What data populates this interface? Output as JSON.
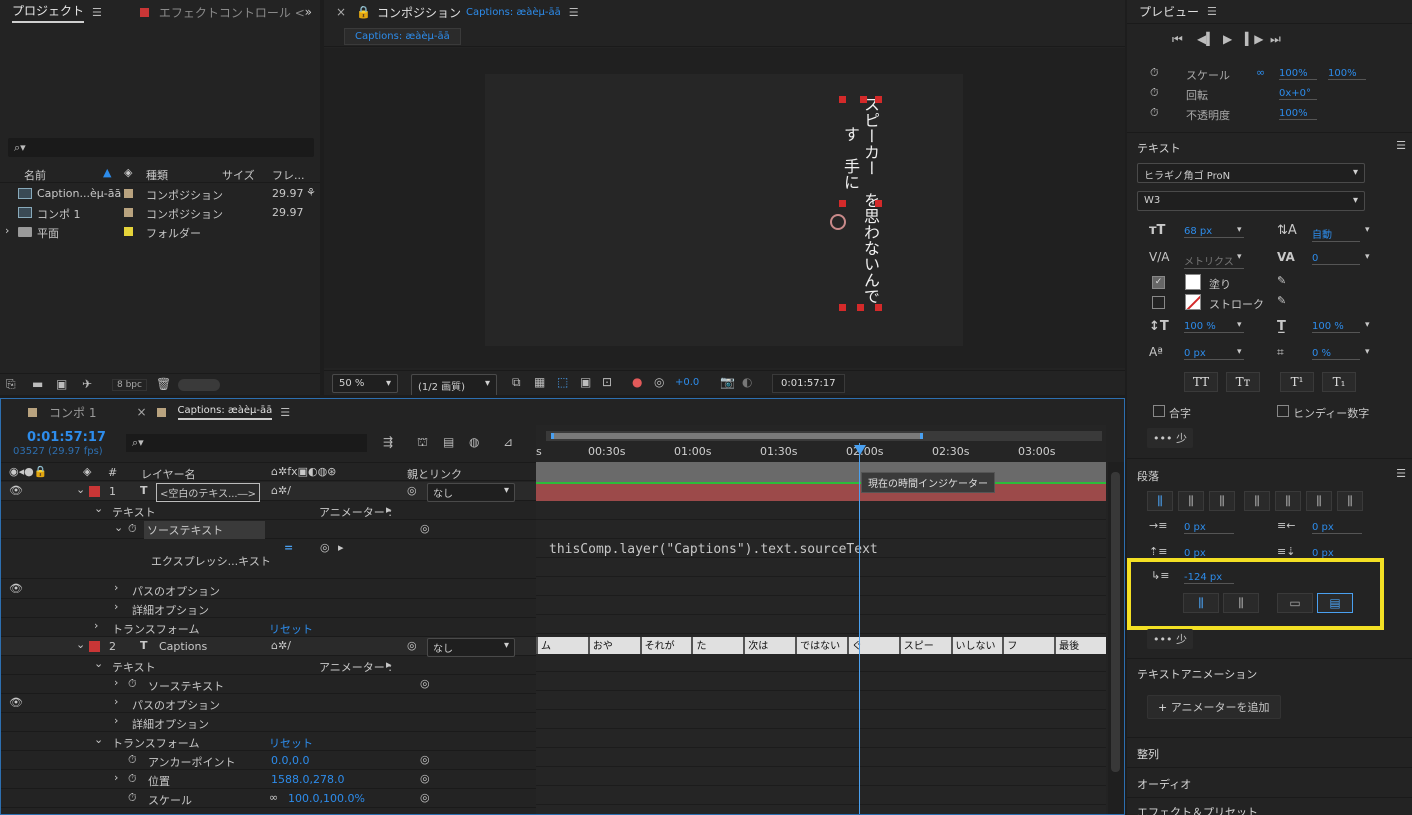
{
  "project": {
    "tab_project": "プロジェクト",
    "tab_effect": "エフェクトコントロール <",
    "cols": {
      "name": "名前",
      "type": "種類",
      "size": "サイズ",
      "fps": "フレ..."
    },
    "items": [
      {
        "name": "Caption...èµ-āā",
        "type": "コンポジション",
        "fps": "29.97",
        "swatch": "#b9a37f"
      },
      {
        "name": "コンポ 1",
        "type": "コンポジション",
        "fps": "29.97",
        "swatch": "#b9a37f"
      },
      {
        "name": "平面",
        "type": "フォルダー",
        "fps": "",
        "swatch": "#e5d43a"
      }
    ],
    "bpc": "8 bpc"
  },
  "comp_viewer": {
    "title": "コンポジション",
    "comp_name": "Captions: æàèµ-āā",
    "tab": "Captions: æàèµ-āā",
    "col1": "スピーカー　を思わないんで",
    "col2": "す　手に",
    "zoom": "50 %",
    "resolution": "(1/2 画質)",
    "exposure": "+0.0",
    "timecode": "0:01:57:17"
  },
  "preview": {
    "title": "プレビュー"
  },
  "transform_props": [
    {
      "label": "スケール",
      "v1": "100%",
      "v2": "100%"
    },
    {
      "label": "回転",
      "v1": "0x+0°",
      "v2": ""
    },
    {
      "label": "不透明度",
      "v1": "100%",
      "v2": ""
    }
  ],
  "text_panel": {
    "title": "テキスト",
    "font": "ヒラギノ角ゴ ProN",
    "style": "W3",
    "size": "68 px",
    "leading": "自動",
    "kerning": "メトリクス",
    "tracking": "0",
    "fill": "塗り",
    "stroke": "ストローク",
    "vscale": "100 %",
    "hscale": "100 %",
    "baseline": "0 px",
    "tsume": "0 %",
    "btn_tt": "TT",
    "btn_tt_small": "Tт",
    "btn_sup": "T¹",
    "btn_sub": "T₁",
    "ligature": "合字",
    "hindi": "ヒンディー数字",
    "less": "少"
  },
  "paragraph": {
    "title": "段落",
    "indent_left": "0 px",
    "indent_right": "0 px",
    "space_before": "0 px",
    "space_after": "0 px",
    "first_line": "-124 px",
    "less": "少"
  },
  "text_anim": {
    "title": "テキストアニメーション",
    "add": "アニメーターを追加"
  },
  "lower_panels": {
    "align": "整列",
    "audio": "オーディオ",
    "effects": "エフェクト＆プリセット"
  },
  "timeline": {
    "tab1": "コンポ 1",
    "tab2": "Captions: æàèµ-āā",
    "time": "0:01:57:17",
    "frames": "03527 (29.97 fps)",
    "col_layer": "レイヤー名",
    "col_parent": "親とリンク",
    "ruler": [
      "s",
      "00:30s",
      "01:00s",
      "01:30s",
      "02:00s",
      "02:30s",
      "03:00s"
    ],
    "tooltip": "現在の時間インジケーター",
    "expression": "thisComp.layer(\"Captions\").text.sourceText",
    "layers": [
      {
        "num": "1",
        "name": "<空白のテキス...―>",
        "parent": "なし",
        "color": "#c93636"
      },
      {
        "num": "2",
        "name": "Captions",
        "parent": "なし",
        "color": "#c93636"
      }
    ],
    "props": {
      "text": "テキスト",
      "animator": "アニメーター :",
      "source_text": "ソーステキスト",
      "expression_label": "エクスプレッシ...キスト",
      "path_opts": "パスのオプション",
      "more_opts": "詳細オプション",
      "transform": "トランスフォーム",
      "reset": "リセット",
      "anchor": "アンカーポイント",
      "anchor_val": "0.0,0.0",
      "position": "位置",
      "position_val": "1588.0,278.0",
      "scale": "スケール",
      "scale_val": "100.0,100.0%"
    },
    "caption_clips": [
      "ム",
      "おや",
      "それが",
      "た",
      "次は",
      "ではない",
      "ぐ",
      "スピー",
      "いしない",
      "フ",
      "最後"
    ]
  },
  "colors": {
    "accent": "#2d8ceb",
    "highlight": "#f3e024",
    "layer_red": "#c93636"
  }
}
